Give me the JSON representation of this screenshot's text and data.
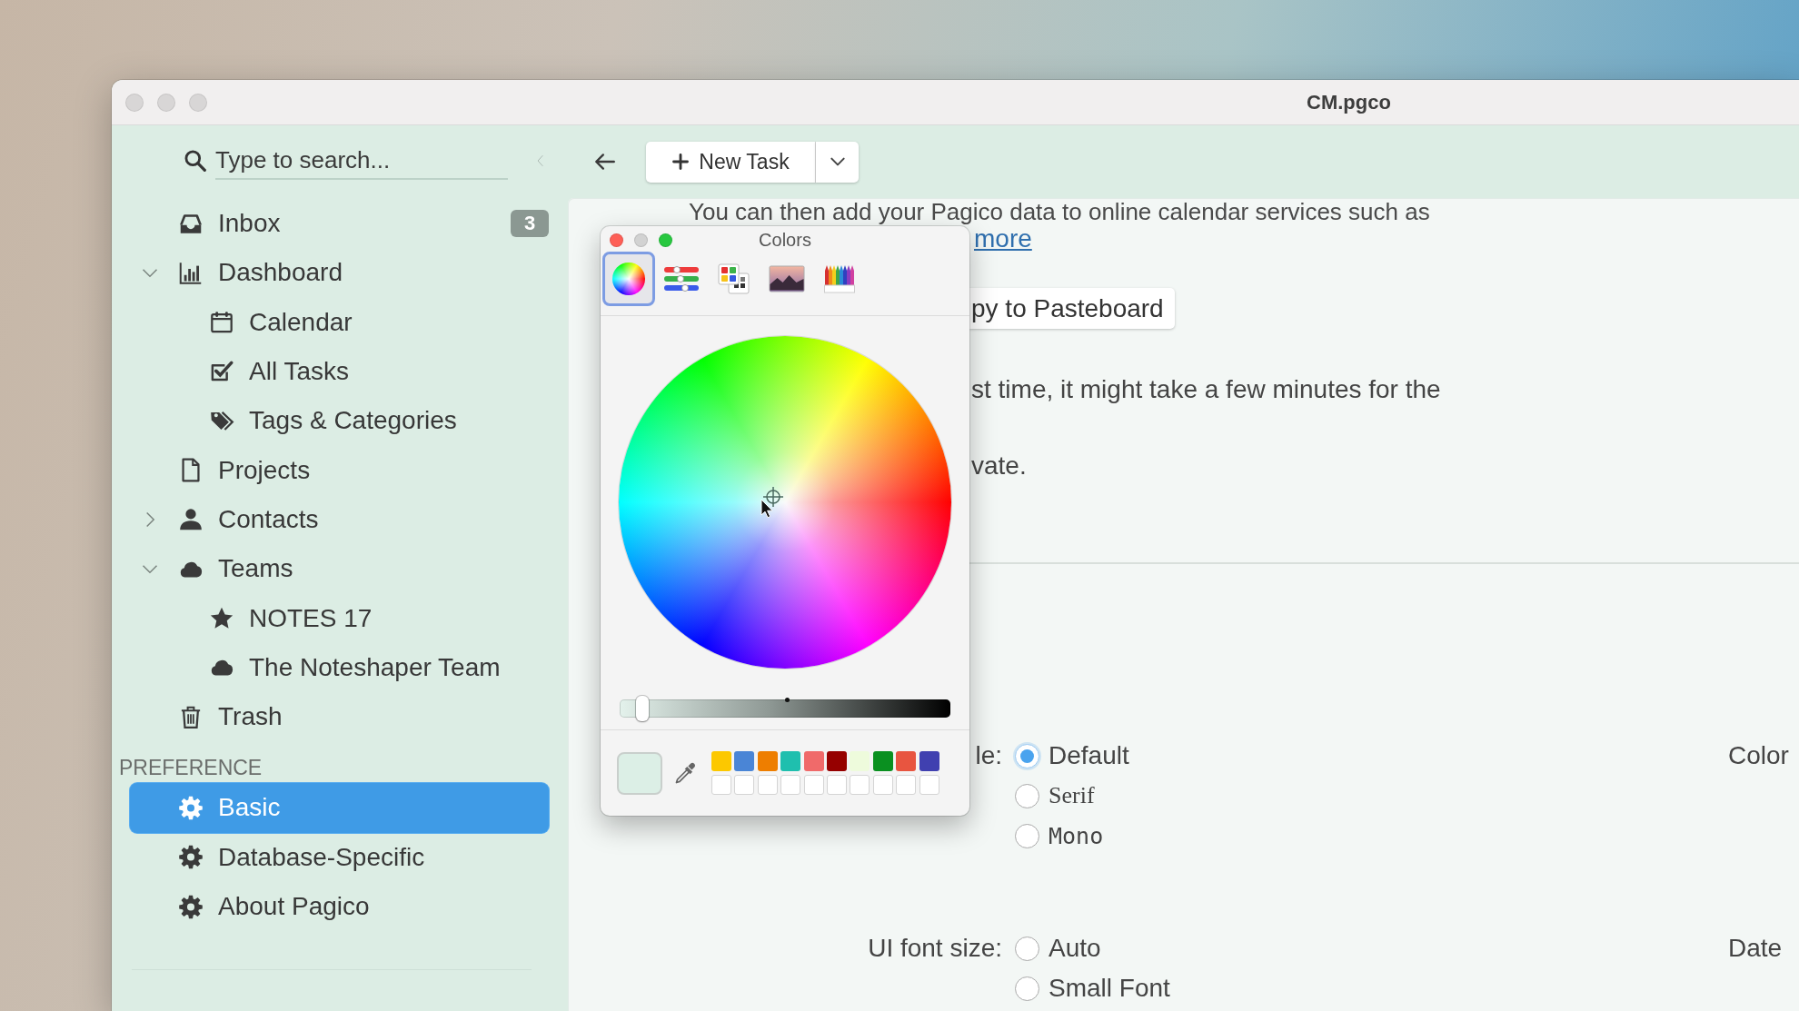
{
  "window": {
    "title": "CM.pgco",
    "active": false
  },
  "sidebar": {
    "search": {
      "placeholder": "Type to search..."
    },
    "items": [
      {
        "label": "Inbox",
        "badge": "3",
        "selected": false
      },
      {
        "label": "Dashboard",
        "selected": false,
        "expanded": true,
        "children": [
          {
            "label": "Calendar",
            "selected": false
          },
          {
            "label": "All Tasks",
            "selected": false
          },
          {
            "label": "Tags & Categories",
            "selected": false
          }
        ]
      },
      {
        "label": "Projects",
        "selected": false
      },
      {
        "label": "Contacts",
        "selected": false,
        "expanded": false
      },
      {
        "label": "Teams",
        "selected": false,
        "expanded": true,
        "children": [
          {
            "label": "NOTES 17",
            "selected": false
          },
          {
            "label": "The Noteshaper Team",
            "selected": false
          }
        ]
      },
      {
        "label": "Trash",
        "selected": false
      }
    ],
    "preference": {
      "title": "PREFERENCE",
      "items": [
        {
          "label": "Basic",
          "selected": true
        },
        {
          "label": "Database-Specific",
          "selected": false
        },
        {
          "label": "About Pagico",
          "selected": false
        }
      ]
    }
  },
  "toolbar": {
    "new_task": "New Task"
  },
  "content": {
    "intro": "You can then add your Pagico data to online calendar services such as",
    "link": "more",
    "copy_button": "py to Pasteboard",
    "note_lines": [
      "st time, it might take a few minutes for the",
      "vate."
    ],
    "settings": [
      {
        "label": "le:",
        "options": [
          {
            "label": "Default",
            "kind": "default",
            "selected": true
          },
          {
            "label": "Serif",
            "kind": "serif",
            "selected": false
          },
          {
            "label": "Mono",
            "kind": "mono",
            "selected": false
          }
        ],
        "side_label": "Color"
      },
      {
        "label": "UI font size:",
        "options": [
          {
            "label": "Auto",
            "kind": "default",
            "selected": false
          },
          {
            "label": "Small Font",
            "kind": "default",
            "selected": false
          }
        ],
        "side_label": "Date"
      }
    ]
  },
  "color_panel": {
    "title": "Colors",
    "active": true,
    "modes": [
      {
        "kind": "wheel",
        "selected": true
      },
      {
        "kind": "sliders",
        "selected": false
      },
      {
        "kind": "palettes",
        "selected": false
      },
      {
        "kind": "image",
        "selected": false
      },
      {
        "kind": "pencils",
        "selected": false
      }
    ],
    "brightness": {
      "level": 0.07
    },
    "current_color": {
      "color": "#dcefe6"
    },
    "swatches": [
      {
        "kind": "filled",
        "color": "#fcc800"
      },
      {
        "kind": "filled",
        "color": "#4a85d6"
      },
      {
        "kind": "filled",
        "color": "#ee7e00"
      },
      {
        "kind": "filled",
        "color": "#1fbfae"
      },
      {
        "kind": "filled",
        "color": "#f06a6a"
      },
      {
        "kind": "filled",
        "color": "#960000"
      },
      {
        "kind": "filled",
        "color": "#eefbdc"
      },
      {
        "kind": "filled",
        "color": "#0a9020"
      },
      {
        "kind": "filled",
        "color": "#e85540"
      },
      {
        "kind": "filled",
        "color": "#4040b0"
      },
      {
        "kind": "empty"
      },
      {
        "kind": "empty"
      },
      {
        "kind": "empty"
      },
      {
        "kind": "empty"
      },
      {
        "kind": "empty"
      },
      {
        "kind": "empty"
      },
      {
        "kind": "empty"
      },
      {
        "kind": "empty"
      },
      {
        "kind": "empty"
      },
      {
        "kind": "empty"
      }
    ]
  }
}
